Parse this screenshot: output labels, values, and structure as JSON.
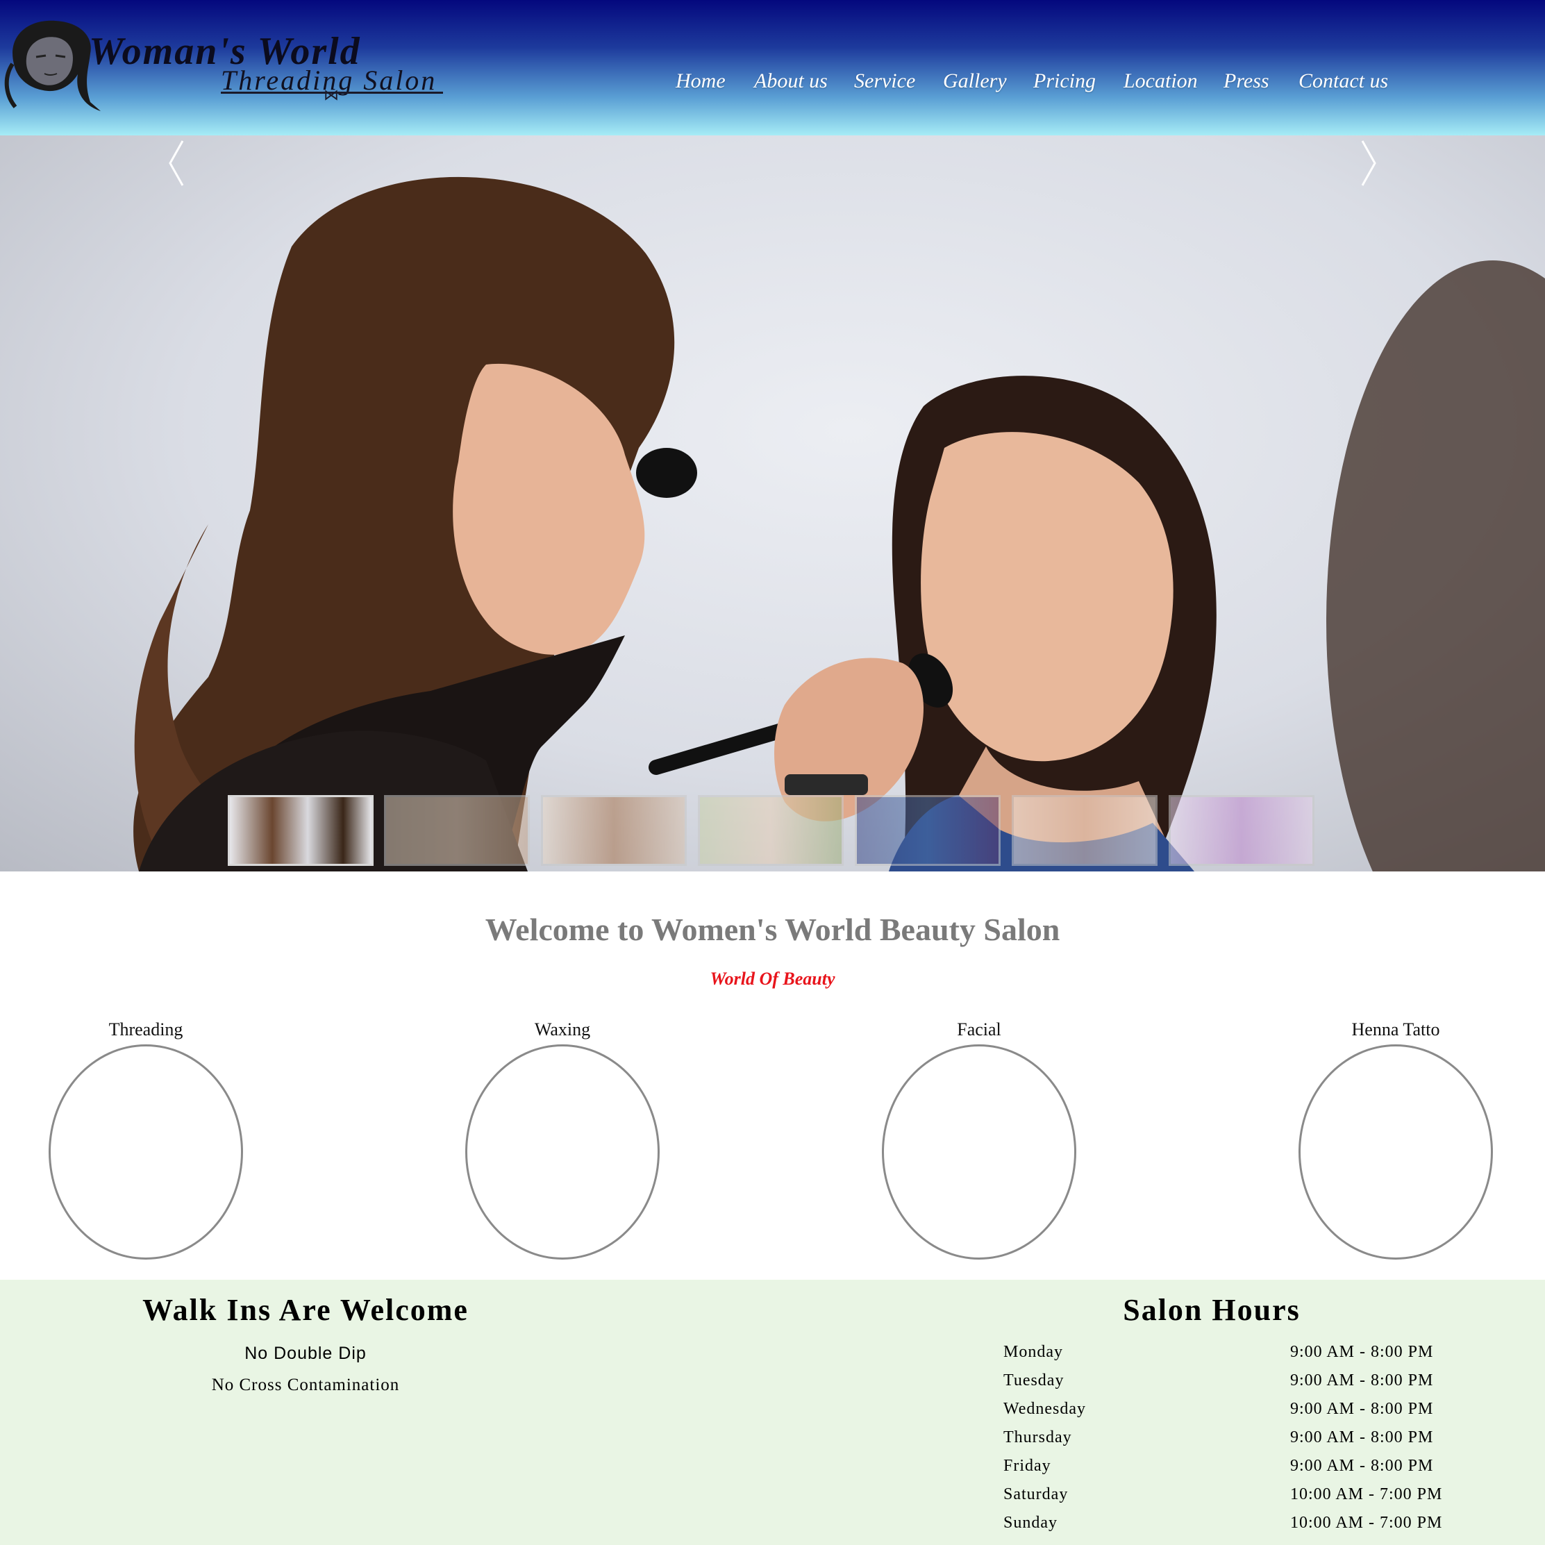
{
  "header": {
    "logo_title": "Woman's World",
    "logo_subtitle": "Threading Salon"
  },
  "nav": [
    {
      "label": "Home"
    },
    {
      "label": "About us"
    },
    {
      "label": "Service"
    },
    {
      "label": "Gallery"
    },
    {
      "label": "Pricing"
    },
    {
      "label": "Location"
    },
    {
      "label": "Press"
    },
    {
      "label": "Contact us"
    }
  ],
  "slider": {
    "prev_icon": "chevron-left-icon",
    "next_icon": "chevron-right-icon",
    "thumbnail_count": 7,
    "active_thumbnail": 1
  },
  "welcome": {
    "title": "Welcome to Women's World Beauty Salon",
    "subtitle": "World Of Beauty"
  },
  "services": [
    {
      "label": "Threading"
    },
    {
      "label": "Waxing"
    },
    {
      "label": "Facial"
    },
    {
      "label": "Henna Tatto"
    }
  ],
  "walk_ins": {
    "title": "Walk Ins Are Welcome",
    "line1": "No Double Dip",
    "line2": "No Cross Contamination"
  },
  "hours": {
    "title": "Salon Hours",
    "rows": [
      {
        "day": "Monday",
        "time": "9:00 AM - 8:00 PM"
      },
      {
        "day": "Tuesday",
        "time": "9:00 AM - 8:00 PM"
      },
      {
        "day": "Wednesday",
        "time": "9:00 AM - 8:00 PM"
      },
      {
        "day": "Thursday",
        "time": "9:00 AM - 8:00 PM"
      },
      {
        "day": "Friday",
        "time": "9:00 AM - 8:00 PM"
      },
      {
        "day": "Saturday",
        "time": "10:00 AM - 7:00 PM"
      },
      {
        "day": "Sunday",
        "time": "10:00 AM - 7:00 PM"
      }
    ]
  },
  "colors": {
    "header_top": "#04087e",
    "header_bottom": "#a6ecf6",
    "tagline_red": "#e8141b",
    "info_band": "#e9f5e4",
    "welcome_gray": "#7a7a7a"
  }
}
